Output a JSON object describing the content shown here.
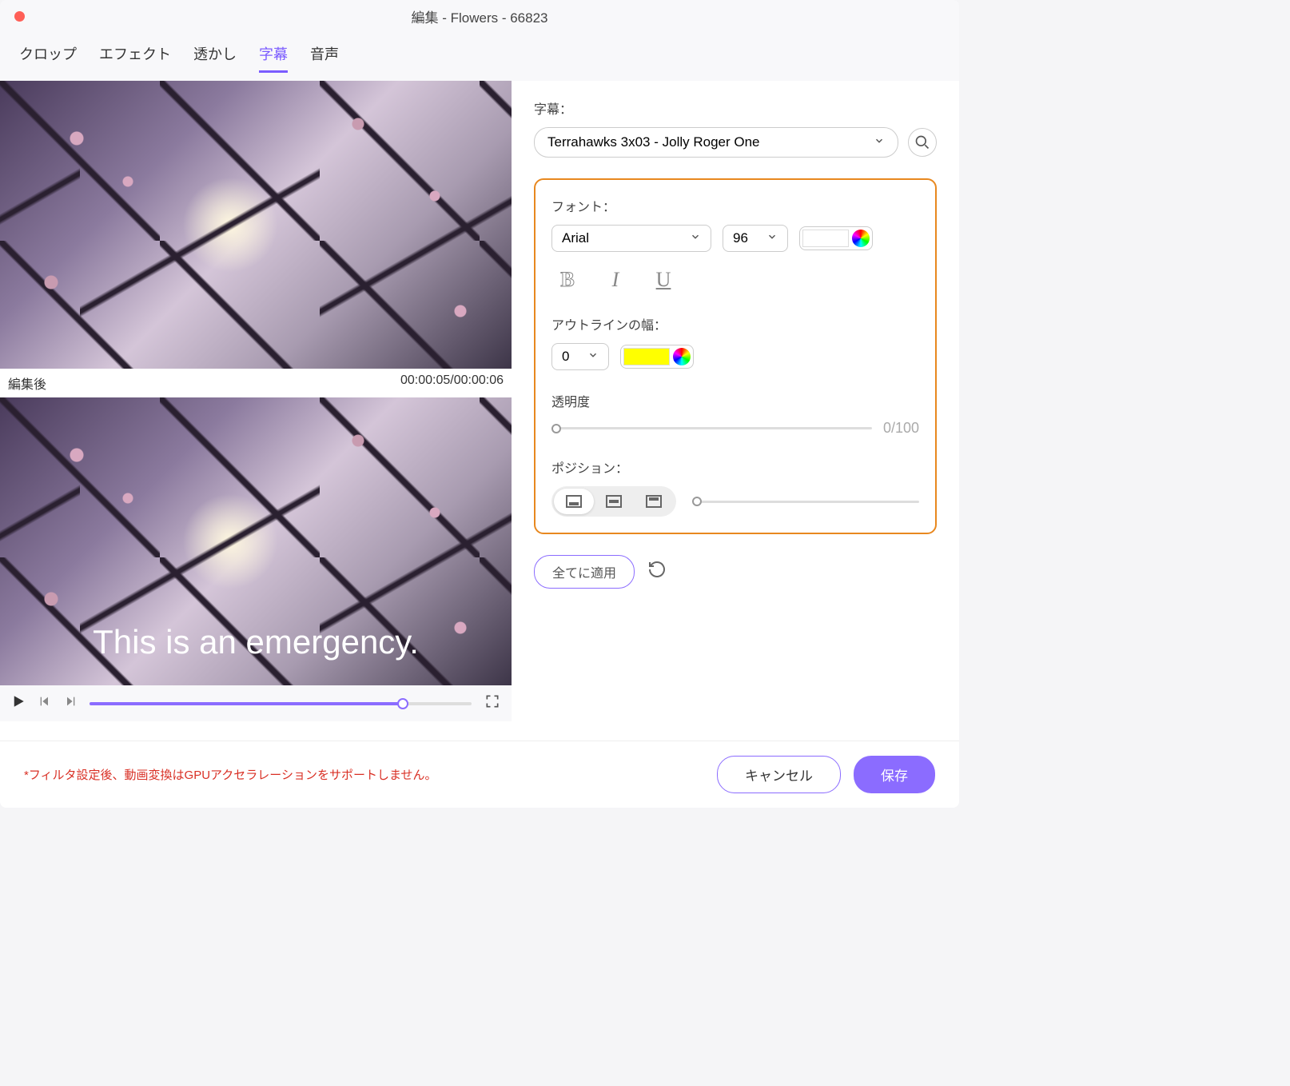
{
  "title": "編集 - Flowers - 66823",
  "tabs": [
    "クロップ",
    "エフェクト",
    "透かし",
    "字幕",
    "音声"
  ],
  "active_tab_index": 3,
  "preview": {
    "label_after": "編集後",
    "timecode": "00:00:05/00:00:06",
    "subtitle_text": "This is an emergency."
  },
  "subtitle": {
    "label": "字幕：",
    "selected": "Terrahawks 3x03 - Jolly Roger One"
  },
  "font": {
    "label": "フォント：",
    "family": "Arial",
    "size": "96"
  },
  "outline": {
    "label": "アウトラインの幅：",
    "width": "0",
    "color": "#ffff00"
  },
  "opacity": {
    "label": "透明度",
    "value": "0/100"
  },
  "position": {
    "label": "ポジション："
  },
  "actions": {
    "apply_all": "全てに適用"
  },
  "footer": {
    "note": "*フィルタ設定後、動画変換はGPUアクセラレーションをサポートしません。",
    "cancel": "キャンセル",
    "save": "保存"
  }
}
